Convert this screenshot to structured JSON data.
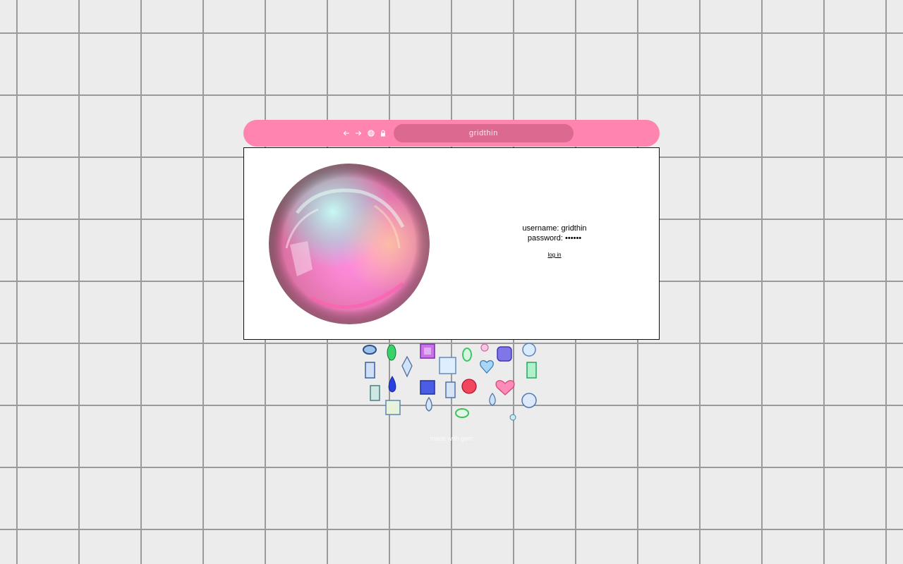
{
  "browser": {
    "address": "gridthin",
    "icons": [
      "arrow-left-icon",
      "arrow-right-icon",
      "globe-icon",
      "lock-icon"
    ]
  },
  "login": {
    "username_label": "username: gridthin",
    "password_label": "password: ••••••",
    "link_label": "log in"
  },
  "footer": {
    "text": "made with gem"
  },
  "colors": {
    "background": "#ececec",
    "grid_line": "#9a9a9a",
    "bar_pink": "#ff85b0",
    "address_pink": "#dc6990",
    "window_bg": "#ffffff"
  }
}
